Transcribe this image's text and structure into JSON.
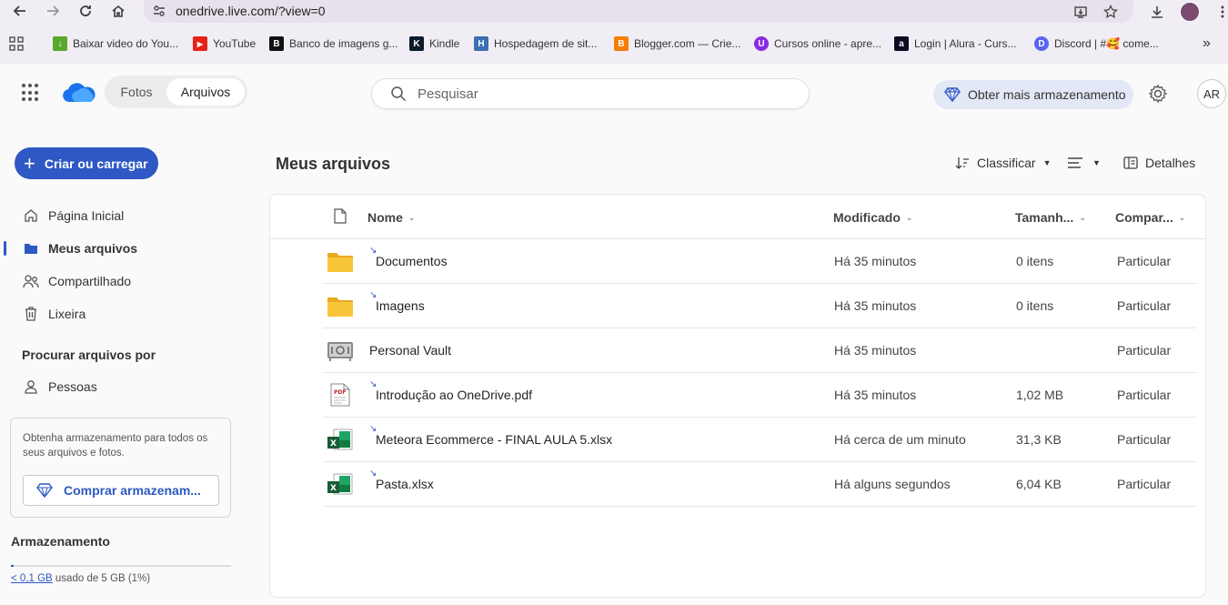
{
  "browser": {
    "url": "onedrive.live.com/?view=0",
    "bookmarks": [
      {
        "label": "Baixar video do You..."
      },
      {
        "label": "YouTube"
      },
      {
        "label": "Banco de imagens g..."
      },
      {
        "label": "Kindle"
      },
      {
        "label": "Hospedagem de sit..."
      },
      {
        "label": "Blogger.com — Crie..."
      },
      {
        "label": "Cursos online - apre..."
      },
      {
        "label": "Login | Alura - Curs..."
      },
      {
        "label": "Discord | #🥰 come..."
      }
    ],
    "overflow": "»"
  },
  "header": {
    "tabs": [
      {
        "label": "Fotos"
      },
      {
        "label": "Arquivos"
      }
    ],
    "search_placeholder": "Pesquisar",
    "storage_button": "Obter mais armazenamento",
    "avatar_initials": "AR"
  },
  "sidebar": {
    "create_button": "Criar ou carregar",
    "items": [
      {
        "label": "Página Inicial"
      },
      {
        "label": "Meus arquivos"
      },
      {
        "label": "Compartilhado"
      },
      {
        "label": "Lixeira"
      }
    ],
    "browse_heading": "Procurar arquivos por",
    "people_item": "Pessoas",
    "promo_text": "Obtenha armazenamento para todos os seus arquivos e fotos.",
    "promo_button": "Comprar armazenam...",
    "storage_title": "Armazenamento",
    "storage_used": "< 0,1 GB",
    "storage_suffix": " usado de 5 GB (1%)",
    "storage_fraction": 0.01
  },
  "main": {
    "title": "Meus arquivos",
    "sort_label": "Classificar",
    "details_label": "Detalhes",
    "columns": {
      "name": "Nome",
      "modified": "Modificado",
      "size": "Tamanh...",
      "sharing": "Compar..."
    },
    "files": [
      {
        "name": "Documentos",
        "modified": "Há 35 minutos",
        "size": "0 itens",
        "sharing": "Particular",
        "type": "folder",
        "sync": true
      },
      {
        "name": "Imagens",
        "modified": "Há 35 minutos",
        "size": "0 itens",
        "sharing": "Particular",
        "type": "folder",
        "sync": true
      },
      {
        "name": "Personal Vault",
        "modified": "Há 35 minutos",
        "size": "",
        "sharing": "Particular",
        "type": "vault",
        "sync": false
      },
      {
        "name": "Introdução ao OneDrive.pdf",
        "modified": "Há 35 minutos",
        "size": "1,02 MB",
        "sharing": "Particular",
        "type": "pdf",
        "sync": true
      },
      {
        "name": "Meteora Ecommerce - FINAL AULA 5.xlsx",
        "modified": "Há cerca de um minuto",
        "size": "31,3 KB",
        "sharing": "Particular",
        "type": "excel",
        "sync": true
      },
      {
        "name": "Pasta.xlsx",
        "modified": "Há alguns segundos",
        "size": "6,04 KB",
        "sharing": "Particular",
        "type": "excel",
        "sync": true
      }
    ]
  },
  "colors": {
    "accent": "#2e58c3",
    "folder": "#f8c43a",
    "excel": "#1d7c44",
    "pdf": "#c4262e"
  }
}
